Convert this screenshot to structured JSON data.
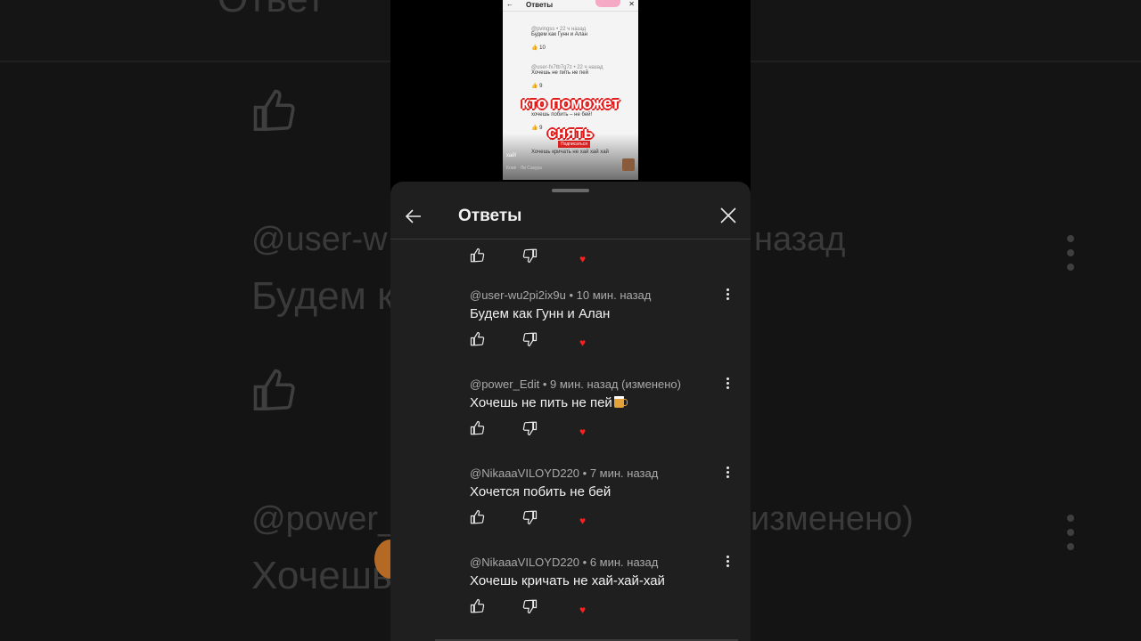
{
  "sheet": {
    "title": "Ответы"
  },
  "comments": [
    {
      "author": "@user-wu2pi2ix9u",
      "time": "10 мин. назад",
      "text": "Будем как Гунн и Алан"
    },
    {
      "author": "@power_Edit",
      "time": "9 мин. назад (изменено)",
      "text": "Хочешь не пить не пей"
    },
    {
      "author": "@NikaaaVILOYD220",
      "time": "7 мин. назад",
      "text": "Хочется побить не бей"
    },
    {
      "author": "@NikaaaVILOYD220",
      "time": "6 мин. назад",
      "text": "Хочешь кричать не хай-хай-хай"
    }
  ],
  "video": {
    "header_title": "Ответы",
    "caption_line1": "кто поможет",
    "caption_line2": "снять",
    "subscribe_label": "Подписаться",
    "mini_comments": [
      {
        "meta": "@pvingss • 22 ч назад",
        "text": "Будем как Гунн и Алан",
        "likes": "10"
      },
      {
        "meta": "@user-fx7tb7g7z • 22 ч назад",
        "text": "Хочешь не пить не пей",
        "likes": "9"
      },
      {
        "meta": "",
        "text": "хочешь побить – не бей!",
        "likes": "9"
      },
      {
        "meta": "",
        "text": "Хочешь кричать не хай хай хай",
        "likes": ""
      }
    ],
    "bottom_text": "Клип · Ли Сакура",
    "side_text": "хай!"
  },
  "background": {
    "ghost_top": "Ответ",
    "ghost_user": "@user-w",
    "ghost_time": "назад",
    "ghost_text1": "Будем к",
    "ghost_power": "@power_",
    "ghost_changed": "изменено)",
    "ghost_text2": "Хочешь"
  },
  "colors": {
    "sheet_bg": "#1f1f1f",
    "heart": "#ff1f1f",
    "caption_outline": "#e21b1b"
  }
}
